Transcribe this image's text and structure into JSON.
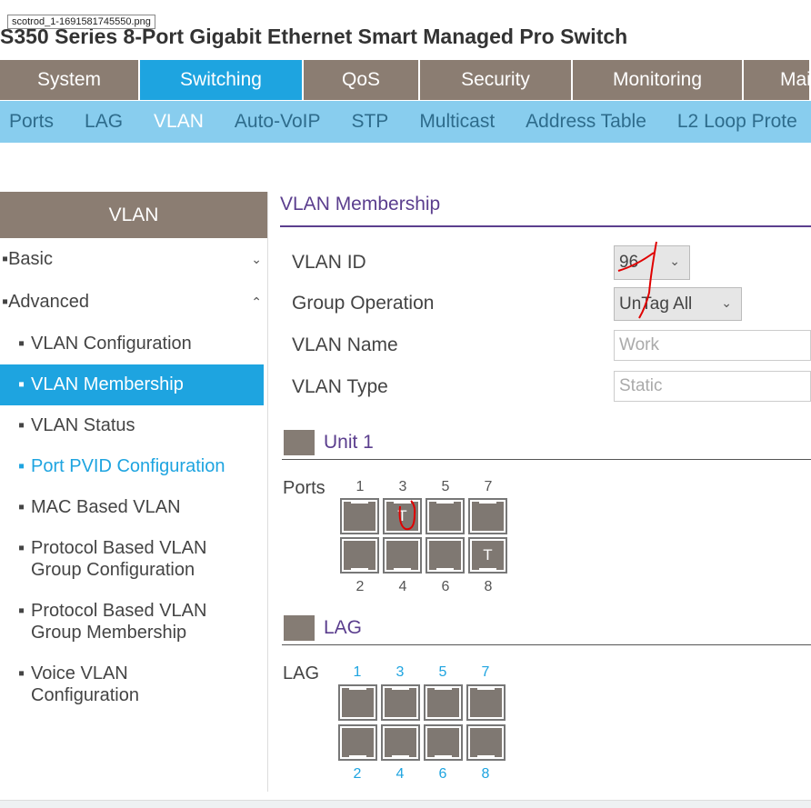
{
  "tooltip": "scotrod_1-1691581745550.png",
  "title": "S350 Series 8-Port Gigabit Ethernet Smart Managed Pro Switch",
  "top_tabs": [
    "System",
    "Switching",
    "QoS",
    "Security",
    "Monitoring",
    "Mai"
  ],
  "sub_tabs": [
    "Ports",
    "LAG",
    "VLAN",
    "Auto-VoIP",
    "STP",
    "Multicast",
    "Address Table",
    "L2 Loop Prote"
  ],
  "sidebar": {
    "header": "VLAN",
    "basic": "Basic",
    "advanced": "Advanced",
    "items": [
      {
        "label": "VLAN Configuration"
      },
      {
        "label": "VLAN Membership"
      },
      {
        "label": "VLAN Status"
      },
      {
        "label": "Port PVID Configuration"
      },
      {
        "label": "MAC Based VLAN"
      },
      {
        "label": "Protocol Based VLAN",
        "label2": "Group Configuration"
      },
      {
        "label": "Protocol Based VLAN",
        "label2": "Group Membership"
      },
      {
        "label": "Voice VLAN",
        "label2": "Configuration"
      }
    ]
  },
  "form": {
    "section_title": "VLAN Membership",
    "vlan_id_label": "VLAN ID",
    "vlan_id_value": "96",
    "group_op_label": "Group Operation",
    "group_op_value": "UnTag All",
    "vlan_name_label": "VLAN Name",
    "vlan_name_value": "Work",
    "vlan_type_label": "VLAN Type",
    "vlan_type_value": "Static"
  },
  "unit": {
    "title": "Unit 1",
    "ports_label": "Ports",
    "top_numbers": [
      "1",
      "3",
      "5",
      "7"
    ],
    "bottom_numbers": [
      "2",
      "4",
      "6",
      "8"
    ],
    "top_ports": [
      "",
      "T",
      "",
      ""
    ],
    "bottom_ports": [
      "",
      "",
      "",
      "T"
    ]
  },
  "lag": {
    "title": "LAG",
    "label": "LAG",
    "top_numbers": [
      "1",
      "3",
      "5",
      "7"
    ],
    "bottom_numbers": [
      "2",
      "4",
      "6",
      "8"
    ]
  },
  "colors": {
    "brand_brown": "#8b7d72",
    "active_blue": "#1ea4e0",
    "subnav_blue": "#88cdee",
    "section_purple": "#5b3e8e",
    "annotation_red": "#e00000"
  }
}
